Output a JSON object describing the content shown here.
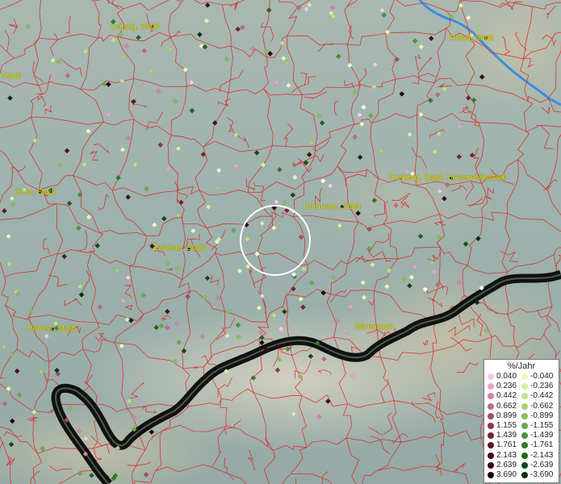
{
  "cities": [
    {
      "id": "leipzig",
      "name": "Leipzig, Stadt"
    },
    {
      "id": "riesa",
      "name": "Riesa, Stadt"
    },
    {
      "id": "stadt",
      "name": "Stadt"
    },
    {
      "id": "freiberg",
      "name": "Freiberg, Stadt, Universitätsstadt"
    },
    {
      "id": "gera",
      "name": "Gera, Stadt"
    },
    {
      "id": "chemnitz",
      "name": "Chemnitz, Stadt"
    },
    {
      "id": "zwickau",
      "name": "Zwickau, Stadt"
    },
    {
      "id": "plauen",
      "name": "Plauen, Stadt"
    },
    {
      "id": "baerenstein",
      "name": "Bärenstein"
    }
  ],
  "legend": {
    "title": "%/Jahr",
    "positive_values": [
      "0.040",
      "0.236",
      "0.442",
      "0.662",
      "0.899",
      "1.155",
      "1.439",
      "1.761",
      "2.143",
      "2.639",
      "3.690"
    ],
    "negative_values": [
      "-0.040",
      "-0.236",
      "-0.442",
      "-0.662",
      "-0.899",
      "-1.155",
      "-1.439",
      "-1.761",
      "-2.143",
      "-2.639",
      "-3.690"
    ],
    "positive_colors": [
      "#f7c8ee",
      "#e6a4cc",
      "#cf85a8",
      "#bb6b8a",
      "#a04e6c",
      "#8a3650",
      "#74243a",
      "#5e1628",
      "#4a0c1a",
      "#360510",
      "#200208"
    ],
    "negative_colors": [
      "#eaf8b8",
      "#d6efa6",
      "#bfe08e",
      "#a4d07a",
      "#86bd63",
      "#68a84c",
      "#4c9038",
      "#347a28",
      "#22621b",
      "#134a10",
      "#083006"
    ]
  },
  "colors": {
    "border_lines": "#e02020",
    "river": "#3a8fe0",
    "country_border": "#111111",
    "label_text": "#e8e100",
    "focus_circle": "#ffffff"
  }
}
